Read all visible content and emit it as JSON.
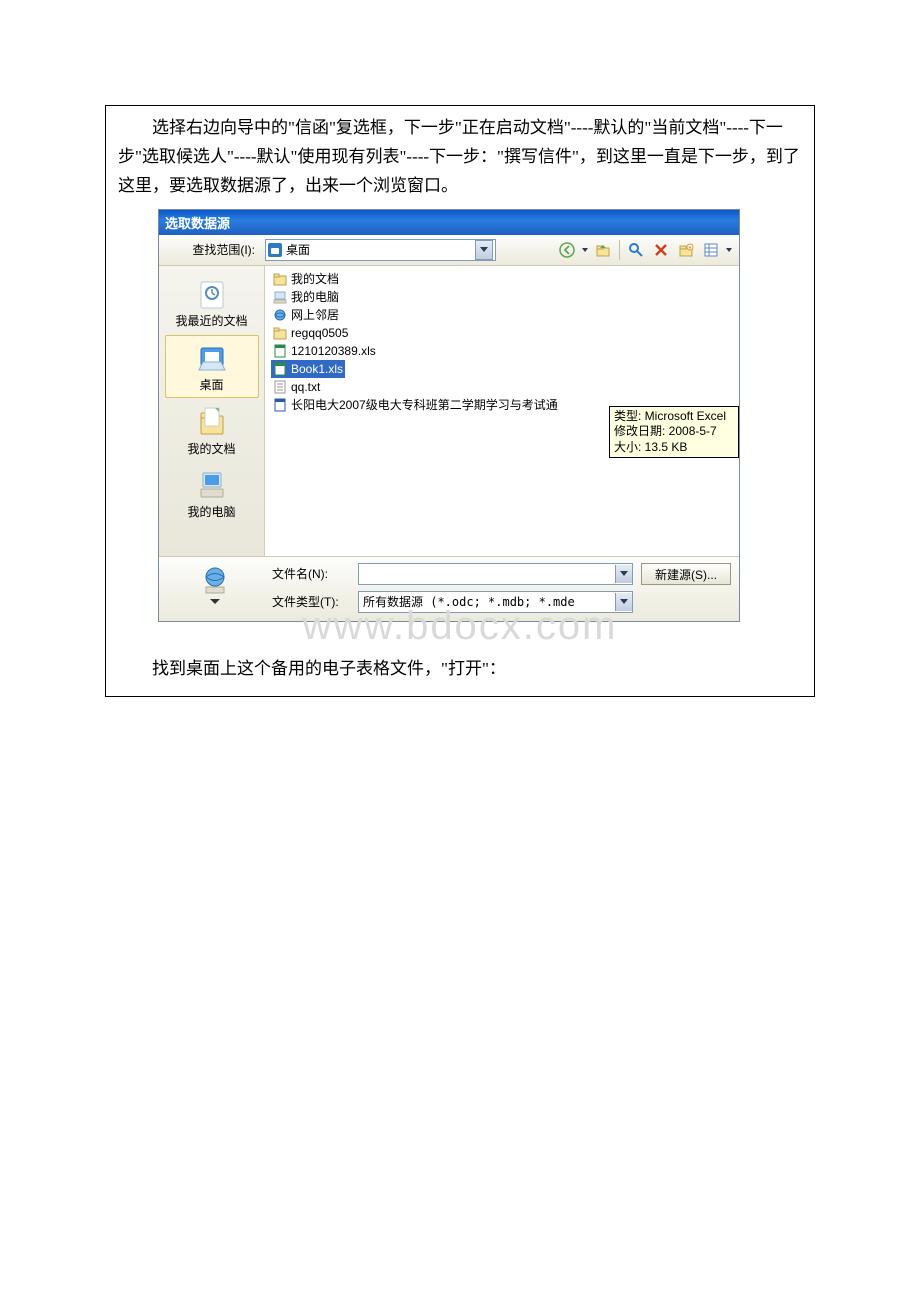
{
  "instructions": {
    "para1": "选择右边向导中的\"信函\"复选框，下一步\"正在启动文档\"----默认的\"当前文档\"----下一步\"选取候选人\"----默认\"使用现有列表\"----下一步：\"撰写信件\"，到这里一直是下一步，到了这里，要选取数据源了，出来一个浏览窗口。"
  },
  "dialog": {
    "title": "选取数据源",
    "lookin_label": "查找范围(I):",
    "lookin_value": "桌面",
    "places": {
      "recent": "我最近的文档",
      "desktop": "桌面",
      "documents": "我的文档",
      "computer": "我的电脑"
    },
    "files": {
      "mydocs": "我的文档",
      "mycomputer": "我的电脑",
      "network": "网上邻居",
      "folder1": "regqq0505",
      "xls1": "1210120389.xls",
      "xls2": "Book1.xls",
      "txt1": "qq.txt",
      "doc1": "长阳电大2007级电大专科班第二学期学习与考试通"
    },
    "tooltip": {
      "line1": "类型: Microsoft Excel",
      "line2": "修改日期: 2008-5-7",
      "line3": "大小: 13.5 KB"
    },
    "filename_label": "文件名(N):",
    "filename_value": "",
    "filetype_label": "文件类型(T):",
    "filetype_value": "所有数据源 (*.odc; *.mdb; *.mde",
    "btn_newsource": "新建源(S)..."
  },
  "watermark": "www.bdocx.com",
  "closing": "找到桌面上这个备用的电子表格文件，\"打开\"："
}
